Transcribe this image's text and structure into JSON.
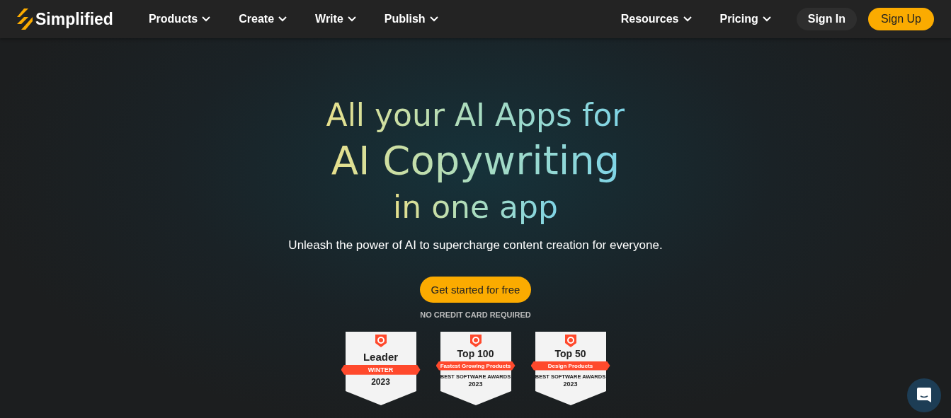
{
  "nav": {
    "brand": "Simplified",
    "menu": [
      {
        "label": "Products"
      },
      {
        "label": "Create"
      },
      {
        "label": "Write"
      },
      {
        "label": "Publish"
      }
    ],
    "right_menu": [
      {
        "label": "Resources"
      },
      {
        "label": "Pricing"
      }
    ],
    "sign_in": "Sign In",
    "sign_up": "Sign Up"
  },
  "hero": {
    "line_1": "All your AI Apps for",
    "line_2": "AI Copywriting",
    "line_3": "in one app",
    "subtitle": "Unleash the power of AI to supercharge content creation for everyone.",
    "cta": "Get started for free",
    "note": "NO CREDIT CARD REQUIRED"
  },
  "badges": [
    {
      "title": "Leader",
      "ribbon": "WINTER",
      "year": "2023"
    },
    {
      "title": "Top 100",
      "ribbon": "Fastest Growing Products",
      "caption": "BEST SOFTWARE AWARDS",
      "year": "2023"
    },
    {
      "title": "Top 50",
      "ribbon": "Design Products",
      "caption": "BEST SOFTWARE AWARDS",
      "year": "2023"
    }
  ]
}
